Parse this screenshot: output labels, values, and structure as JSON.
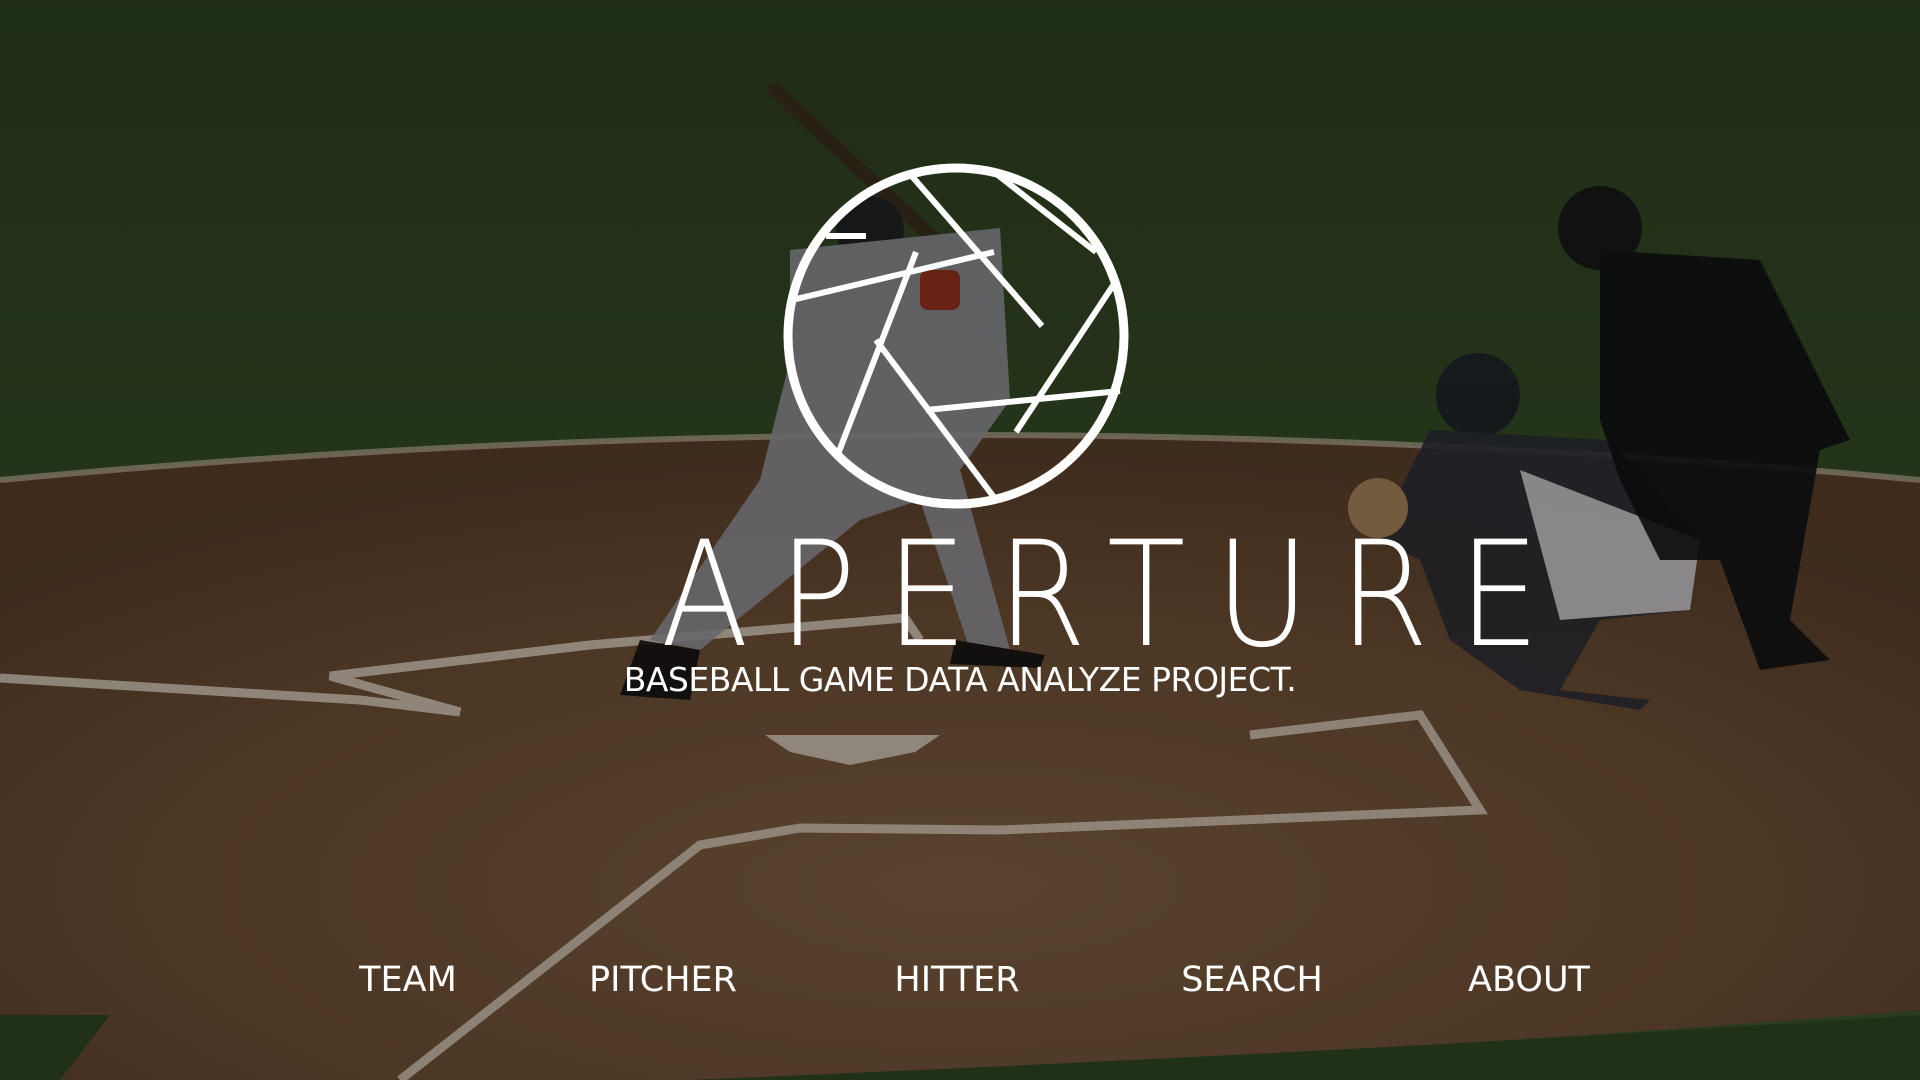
{
  "hero": {
    "title": "APERTURE",
    "tagline": "BASEBALL GAME DATA ANALYZE PROJECT.",
    "logo_icon": "aperture-shutter-icon"
  },
  "nav": {
    "items": [
      {
        "label": "TEAM"
      },
      {
        "label": "PITCHER"
      },
      {
        "label": "HITTER"
      },
      {
        "label": "SEARCH"
      },
      {
        "label": "ABOUT"
      }
    ]
  },
  "colors": {
    "text": "#ffffff",
    "grass": "#3f5a2c",
    "dirt": "#7a5a3c",
    "chalk": "#e8e2d6"
  }
}
